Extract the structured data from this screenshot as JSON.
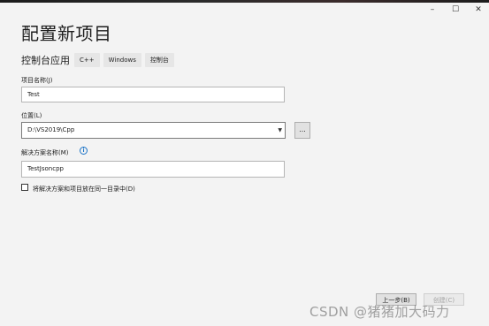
{
  "window": {
    "minimize": "–",
    "maximize": "☐",
    "close": "✕"
  },
  "header": {
    "title": "配置新项目",
    "subtitle": "控制台应用"
  },
  "tags": [
    "C++",
    "Windows",
    "控制台"
  ],
  "project_name": {
    "label": "项目名称(J)",
    "value": "Test"
  },
  "location": {
    "label": "位置(L)",
    "value": "D:\\VS2019\\Cpp",
    "browse": "..."
  },
  "solution": {
    "label": "解决方案名称(M)",
    "value": "TestJsoncpp",
    "info": "i"
  },
  "same_dir": {
    "label": "将解决方案和项目放在同一目录中(D)",
    "checked": false
  },
  "footer": {
    "back": "上一步(B)",
    "create": "创建(C)"
  },
  "watermark": "CSDN @猪猪加大码力"
}
